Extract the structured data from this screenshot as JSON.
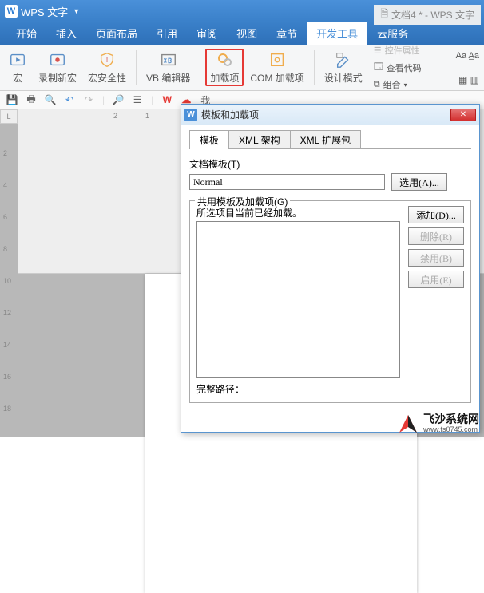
{
  "titlebar": {
    "app_name": "WPS 文字",
    "doc_title": "文档4 * - WPS 文字"
  },
  "tabs": [
    {
      "label": "开始"
    },
    {
      "label": "插入"
    },
    {
      "label": "页面布局"
    },
    {
      "label": "引用"
    },
    {
      "label": "审阅"
    },
    {
      "label": "视图"
    },
    {
      "label": "章节"
    },
    {
      "label": "开发工具",
      "active": true
    },
    {
      "label": "云服务"
    }
  ],
  "ribbon": {
    "macro": "宏",
    "record_macro": "录制新宏",
    "macro_security": "宏安全性",
    "vb_editor": "VB 编辑器",
    "addins": "加载项",
    "com_addins": "COM 加载项",
    "design_mode": "设计模式",
    "ctrl_props": "控件属性",
    "view_code": "查看代码",
    "combine": "组合"
  },
  "qat": {
    "me_label": "我"
  },
  "ruler": {
    "corner": "L",
    "h_ticks": [
      "2",
      "1"
    ],
    "v_ticks": [
      "2",
      "4",
      "6",
      "8",
      "10",
      "12",
      "14",
      "16",
      "18"
    ]
  },
  "dialog": {
    "title": "模板和加载项",
    "tabs": [
      {
        "label": "模板",
        "active": true
      },
      {
        "label": "XML 架构"
      },
      {
        "label": "XML 扩展包"
      }
    ],
    "doc_template_label": "文档模板(T)",
    "doc_template_value": "Normal",
    "select_btn": "选用(A)...",
    "group_label": "共用模板及加载项(G)",
    "list_caption": "所选项目当前已经加载。",
    "btn_add": "添加(D)...",
    "btn_remove": "删除(R)",
    "btn_disable": "禁用(B)",
    "btn_enable": "启用(E)",
    "full_path_label": "完整路径："
  },
  "watermark": {
    "name": "飞沙系统网",
    "url": "www.fs0745.com"
  }
}
